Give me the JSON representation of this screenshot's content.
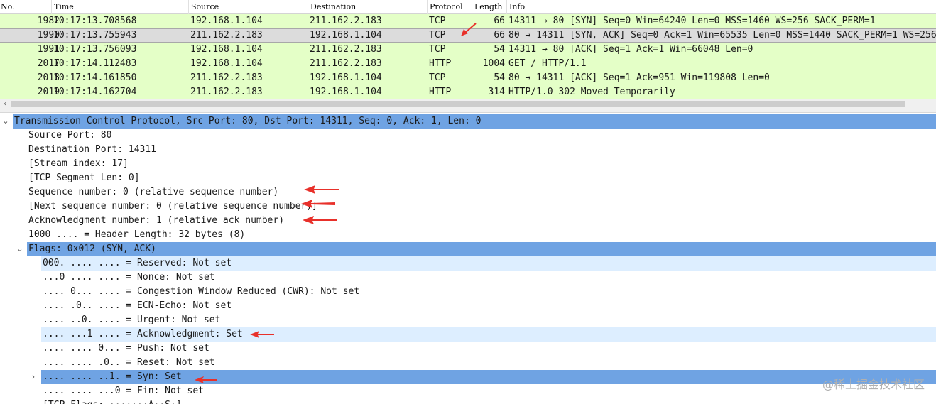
{
  "packet_list": {
    "columns": [
      "No.",
      "Time",
      "Source",
      "Destination",
      "Protocol",
      "Length",
      "Info"
    ],
    "rows": [
      {
        "no": "1982",
        "time": "10:17:13.708568",
        "source": "192.168.1.104",
        "destination": "211.162.2.183",
        "protocol": "TCP",
        "length": "66",
        "info": "14311 → 80 [SYN] Seq=0 Win=64240 Len=0 MSS=1460 WS=256 SACK_PERM=1"
      },
      {
        "no": "1990",
        "time": "10:17:13.755943",
        "source": "211.162.2.183",
        "destination": "192.168.1.104",
        "protocol": "TCP",
        "length": "66",
        "info": "80 → 14311 [SYN, ACK] Seq=0 Ack=1 Win=65535 Len=0 MSS=1440 SACK_PERM=1 WS=256"
      },
      {
        "no": "1991",
        "time": "10:17:13.756093",
        "source": "192.168.1.104",
        "destination": "211.162.2.183",
        "protocol": "TCP",
        "length": "54",
        "info": "14311 → 80 [ACK] Seq=1 Ack=1 Win=66048 Len=0"
      },
      {
        "no": "2017",
        "time": "10:17:14.112483",
        "source": "192.168.1.104",
        "destination": "211.162.2.183",
        "protocol": "HTTP",
        "length": "1004",
        "info": "GET / HTTP/1.1"
      },
      {
        "no": "2018",
        "time": "10:17:14.161850",
        "source": "211.162.2.183",
        "destination": "192.168.1.104",
        "protocol": "TCP",
        "length": "54",
        "info": "80 → 14311 [ACK] Seq=1 Ack=951 Win=119808 Len=0"
      },
      {
        "no": "2019",
        "time": "10:17:14.162704",
        "source": "211.162.2.183",
        "destination": "192.168.1.104",
        "protocol": "HTTP",
        "length": "314",
        "info": "HTTP/1.0 302 Moved Temporarily"
      }
    ],
    "selected_row": 1
  },
  "details": {
    "tcp_header": "Transmission Control Protocol, Src Port: 80, Dst Port: 14311, Seq: 0, Ack: 1, Len: 0",
    "source_port": "Source Port: 80",
    "destination_port": "Destination Port: 14311",
    "stream_index": "[Stream index: 17]",
    "segment_len": "[TCP Segment Len: 0]",
    "seq_number": "Sequence number: 0    (relative sequence number)",
    "next_seq_number": "[Next sequence number: 0    (relative sequence number)]",
    "ack_number": "Acknowledgment number: 1    (relative ack number)",
    "header_length": "1000 .... = Header Length: 32 bytes (8)",
    "flags": "Flags: 0x012 (SYN, ACK)",
    "flag_reserved": "000. .... .... = Reserved: Not set",
    "flag_nonce": "...0 .... .... = Nonce: Not set",
    "flag_cwr": ".... 0... .... = Congestion Window Reduced (CWR): Not set",
    "flag_ecn": ".... .0.. .... = ECN-Echo: Not set",
    "flag_urgent": ".... ..0. .... = Urgent: Not set",
    "flag_ack": ".... ...1 .... = Acknowledgment: Set",
    "flag_push": ".... .... 0... = Push: Not set",
    "flag_reset": ".... .... .0.. = Reset: Not set",
    "flag_syn": ".... .... ..1. = Syn: Set",
    "flag_fin": ".... .... ...0 = Fin: Not set",
    "flags_summary_partial": "[TCP Flags: ·······A··S·]"
  },
  "watermark": "@稀土掘金技术社区",
  "colors": {
    "tcp_row_bg": "#e4ffc7",
    "selected_row_bg": "#dcdcdc",
    "highlight_blue": "#6fa3e3",
    "highlight_light": "#ddeeff",
    "annotation_red": "#e8302a"
  }
}
